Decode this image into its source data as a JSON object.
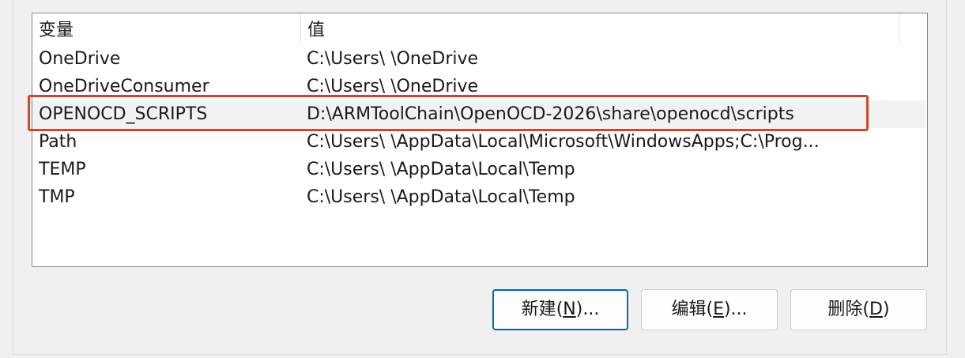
{
  "list": {
    "columns": [
      "变量",
      "值"
    ],
    "rows": [
      {
        "name": "OneDrive",
        "value": "C:\\Users\\     \\OneDrive"
      },
      {
        "name": "OneDriveConsumer",
        "value": "C:\\Users\\     \\OneDrive"
      },
      {
        "name": "OPENOCD_SCRIPTS",
        "value": "D:\\ARMToolChain\\OpenOCD-2026\\share\\openocd\\scripts",
        "selected": true
      },
      {
        "name": "Path",
        "value": "C:\\Users\\     \\AppData\\Local\\Microsoft\\WindowsApps;C:\\Prog..."
      },
      {
        "name": "TEMP",
        "value": "C:\\Users\\     \\AppData\\Local\\Temp"
      },
      {
        "name": "TMP",
        "value": "C:\\Users\\     \\AppData\\Local\\Temp"
      }
    ]
  },
  "buttons": {
    "new": {
      "pre": "新建(",
      "key": "N",
      "post": ")..."
    },
    "edit": {
      "pre": "编辑(",
      "key": "E",
      "post": ")..."
    },
    "delete": {
      "pre": "删除(",
      "key": "D",
      "post": ")"
    }
  },
  "colors": {
    "highlight_border": "#d2452c",
    "default_button_border": "#0067c0"
  }
}
